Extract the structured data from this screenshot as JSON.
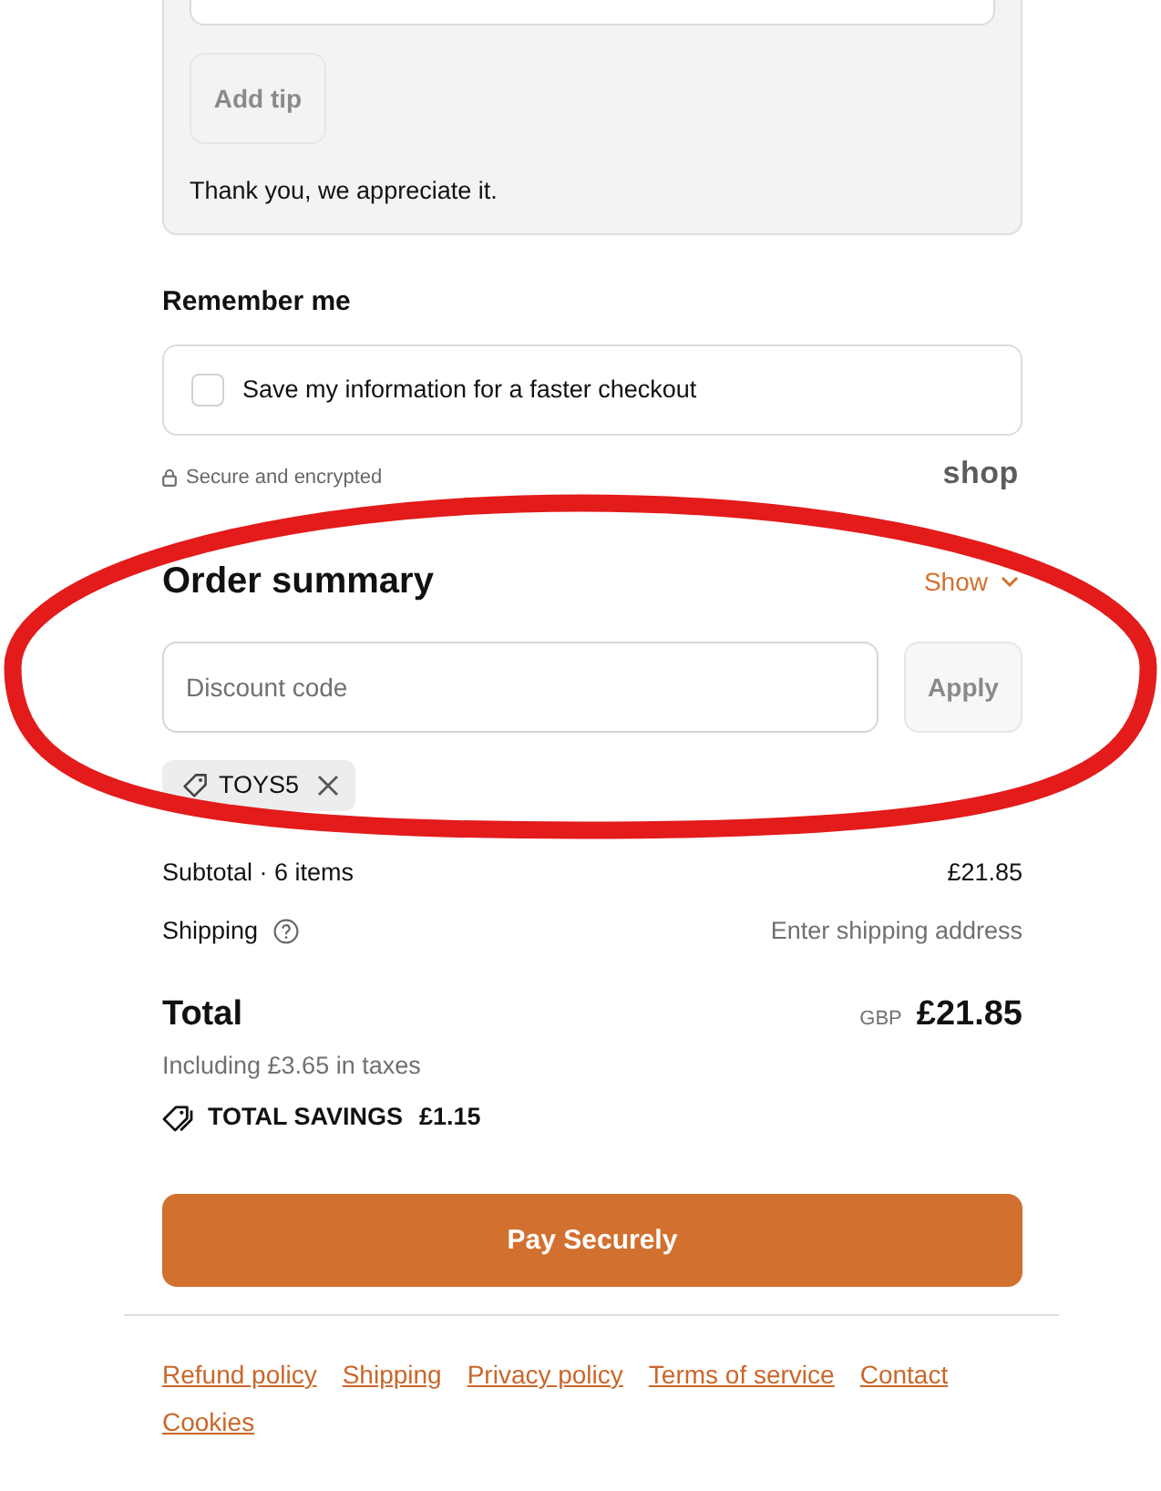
{
  "tip": {
    "button": "Add tip",
    "button_disabled": true,
    "note": "Thank you, we appreciate it."
  },
  "remember_me": {
    "heading": "Remember me",
    "checkbox": {
      "label": "Save my information for a faster checkout",
      "checked": false
    }
  },
  "security": {
    "note": "Secure and encrypted",
    "logo": "shop"
  },
  "order_summary": {
    "heading": "Order summary",
    "toggle": {
      "label": "Show",
      "expanded": false
    },
    "discount": {
      "placeholder": "Discount code",
      "button": "Apply",
      "button_disabled": true
    },
    "applied_codes": [
      {
        "code": "TOYS5"
      }
    ],
    "lines": [
      {
        "label": "Subtotal · 6 items",
        "value": "£21.85",
        "muted": false
      },
      {
        "label": "Shipping",
        "value": "Enter shipping address",
        "help": true,
        "muted": true
      }
    ],
    "total": {
      "label": "Total",
      "currency": "GBP",
      "amount": "£21.85",
      "taxes": "Including £3.65 in taxes"
    },
    "savings": {
      "label": "TOTAL SAVINGS",
      "amount": "£1.15"
    }
  },
  "pay_button": "Pay Securely",
  "footer_links": [
    "Refund policy",
    "Shipping",
    "Privacy policy",
    "Terms of service",
    "Contact",
    "Cookies"
  ],
  "annotation": {
    "kind": "ellipse"
  }
}
